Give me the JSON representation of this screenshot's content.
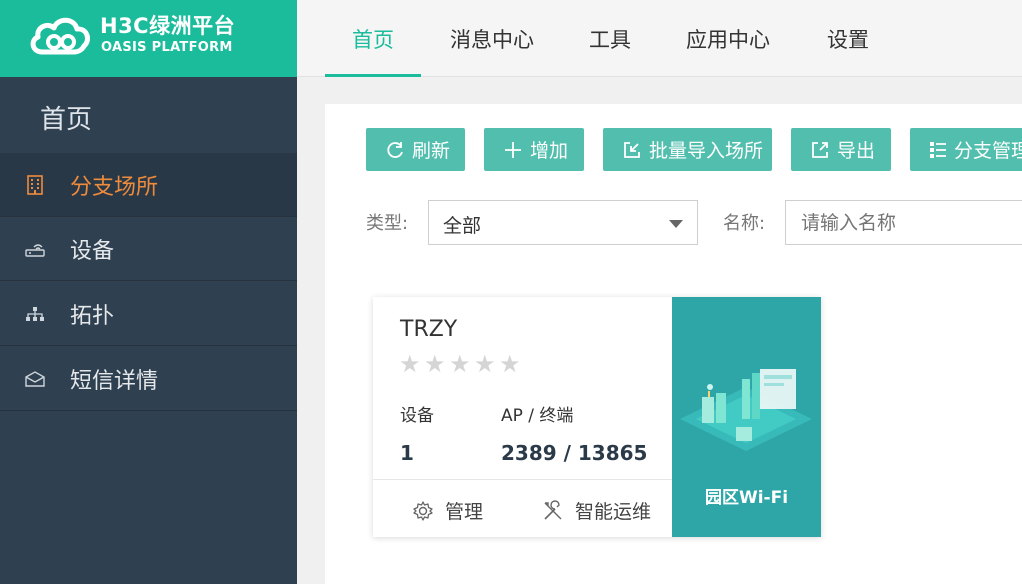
{
  "brand": {
    "title": "H3C绿洲平台",
    "subtitle": "OASIS PLATFORM"
  },
  "sidebar": {
    "home": "首页",
    "items": [
      {
        "label": "分支场所",
        "icon": "building-icon",
        "active": true
      },
      {
        "label": "设备",
        "icon": "router-icon",
        "active": false
      },
      {
        "label": "拓扑",
        "icon": "topology-icon",
        "active": false
      },
      {
        "label": "短信详情",
        "icon": "envelope-icon",
        "active": false
      }
    ]
  },
  "topnav": {
    "tabs": [
      {
        "label": "首页",
        "active": true
      },
      {
        "label": "消息中心",
        "active": false
      },
      {
        "label": "工具",
        "active": false
      },
      {
        "label": "应用中心",
        "active": false
      },
      {
        "label": "设置",
        "active": false
      }
    ]
  },
  "toolbar": {
    "refresh": "刷新",
    "add": "增加",
    "batch_import": "批量导入场所",
    "export": "导出",
    "branch_manage": "分支管理"
  },
  "filters": {
    "type_label": "类型:",
    "type_value": "全部",
    "name_label": "名称:",
    "name_placeholder": "请输入名称"
  },
  "card": {
    "name": "TRZY",
    "rating": 0,
    "rating_max": 5,
    "device_label": "设备",
    "device_value": "1",
    "ap_label": "AP / 终端",
    "ap_value": "2389 / 13865",
    "manage": "管理",
    "ops": "智能运维",
    "scene": "园区Wi-Fi"
  },
  "colors": {
    "brand": "#1abc9c",
    "sidebar": "#2f4050",
    "button": "#52bfae",
    "active_side": "#ef8b3c",
    "card_right": "#2ea6a7"
  }
}
